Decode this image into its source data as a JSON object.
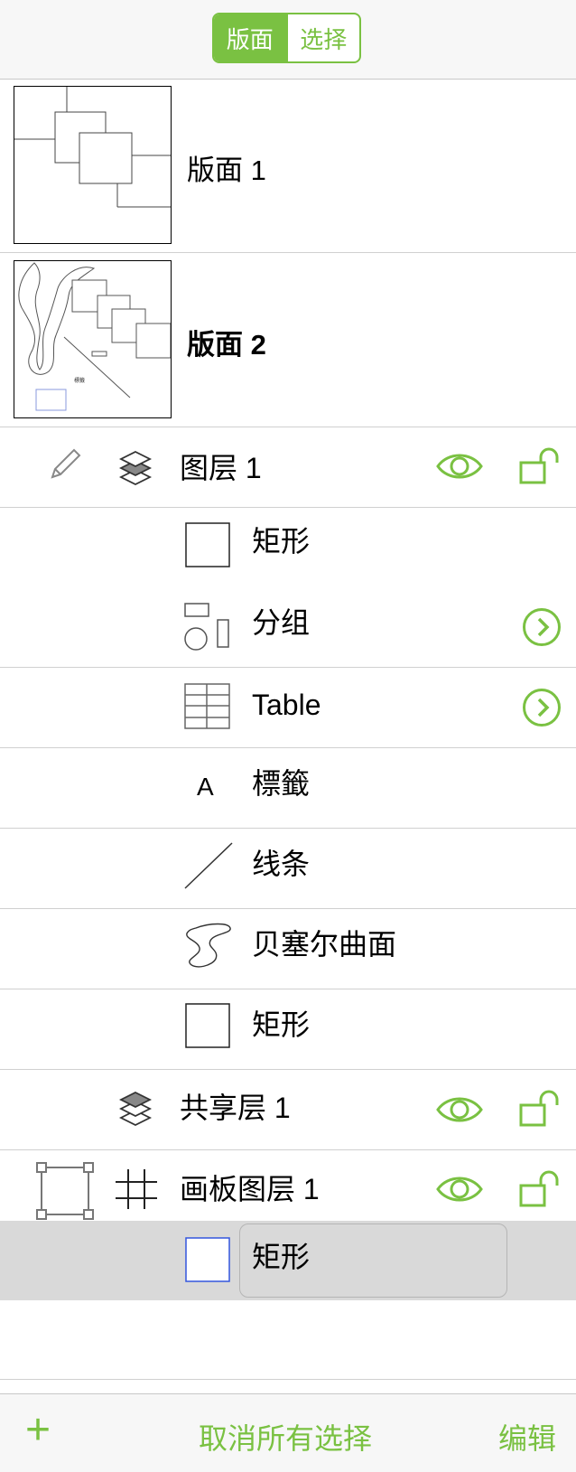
{
  "segmented": {
    "left_label": "版面",
    "right_label": "选择",
    "selected": "版面"
  },
  "canvases": [
    {
      "label": "版面 1"
    },
    {
      "label": "版面 2"
    }
  ],
  "thumb2_text": "標籤",
  "layers": {
    "layer1": {
      "label": "图层 1"
    },
    "items": [
      {
        "label": "矩形"
      },
      {
        "label": "分组"
      },
      {
        "label": "Table"
      },
      {
        "label": "標籤",
        "glyph": "A"
      },
      {
        "label": "线条"
      },
      {
        "label": "贝塞尔曲面"
      },
      {
        "label": "矩形"
      }
    ],
    "shared": {
      "label": "共享层 1"
    },
    "artboard": {
      "label": "画板图层 1"
    },
    "selected_item": {
      "label": "矩形"
    }
  },
  "bottombar": {
    "add_label": "+",
    "deselect_label": "取消所有选择",
    "edit_label": "编辑"
  },
  "colors": {
    "accent": "#7ac142",
    "selected_row": "#d9d9d9",
    "selection_outline": "#3355dd"
  }
}
